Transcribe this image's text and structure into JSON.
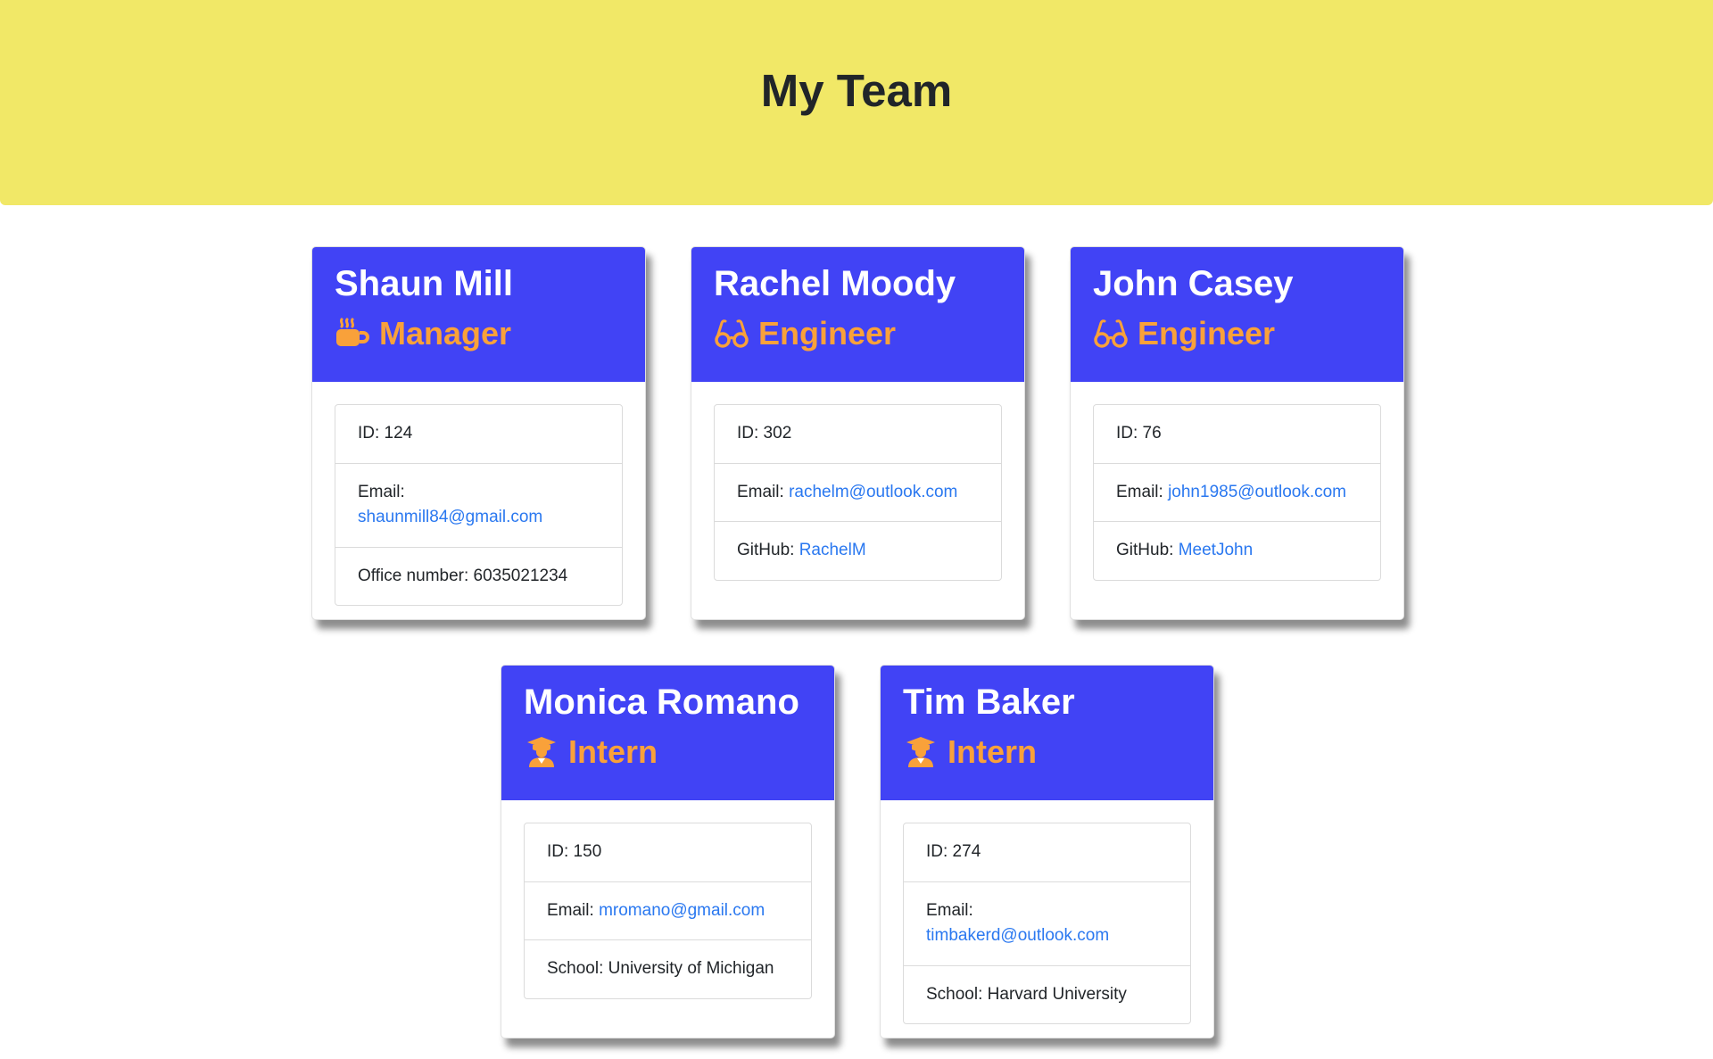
{
  "header": {
    "title": "My Team"
  },
  "colors": {
    "header_bg": "#f1e867",
    "card_header_bg": "#4143f5",
    "role_color": "#f9a13a",
    "link_color": "#2a78f0"
  },
  "cards": [
    {
      "name": "Shaun Mill",
      "role": "Manager",
      "role_icon": "mug-hot-icon",
      "id_label": "ID: 124",
      "email_label": "Email:",
      "email": "shaunmill84@gmail.com",
      "extra_label": "Office number: 6035021234",
      "extra_link": ""
    },
    {
      "name": "Rachel Moody",
      "role": "Engineer",
      "role_icon": "glasses-icon",
      "id_label": "ID: 302",
      "email_label": "Email:",
      "email": "rachelm@outlook.com",
      "extra_label": "GitHub:",
      "extra_link": "RachelM"
    },
    {
      "name": "John Casey",
      "role": "Engineer",
      "role_icon": "glasses-icon",
      "id_label": "ID: 76",
      "email_label": "Email:",
      "email": "john1985@outlook.com",
      "extra_label": "GitHub:",
      "extra_link": "MeetJohn"
    },
    {
      "name": "Monica Romano",
      "role": "Intern",
      "role_icon": "graduate-icon",
      "id_label": "ID: 150",
      "email_label": "Email:",
      "email": "mromano@gmail.com",
      "extra_label": "School: University of Michigan",
      "extra_link": ""
    },
    {
      "name": "Tim Baker",
      "role": "Intern",
      "role_icon": "graduate-icon",
      "id_label": "ID: 274",
      "email_label": "Email:",
      "email": "timbakerd@outlook.com",
      "extra_label": "School: Harvard University",
      "extra_link": ""
    }
  ]
}
